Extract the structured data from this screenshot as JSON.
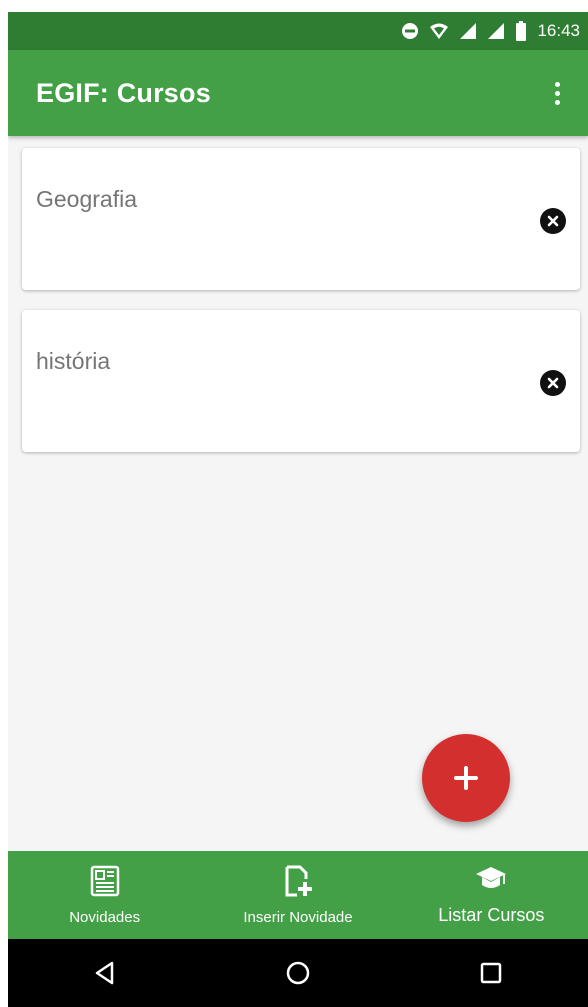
{
  "status_bar": {
    "time": "16:43",
    "icons": [
      "do-not-disturb-icon",
      "wifi-icon",
      "signal-icon",
      "signal-icon",
      "battery-icon"
    ]
  },
  "app_bar": {
    "title": "EGIF: Cursos",
    "menu_icon": "more-vert-icon"
  },
  "courses": [
    {
      "name": "Geografia",
      "remove_icon": "cancel-icon"
    },
    {
      "name": "história",
      "remove_icon": "cancel-icon"
    }
  ],
  "fab": {
    "icon": "plus-icon",
    "color": "#d32f2f"
  },
  "bottom_nav": {
    "items": [
      {
        "label": "Novidades",
        "icon": "newspaper-icon"
      },
      {
        "label": "Inserir Novidade",
        "icon": "add-document-icon"
      },
      {
        "label": "Listar Cursos",
        "icon": "graduation-cap-icon",
        "active": true
      }
    ]
  },
  "system_nav": {
    "icons": [
      "back-icon",
      "home-icon",
      "recents-icon"
    ]
  },
  "colors": {
    "status_bar": "#2e7d32",
    "primary": "#43a047",
    "accent": "#d32f2f",
    "background": "#f5f5f5"
  }
}
